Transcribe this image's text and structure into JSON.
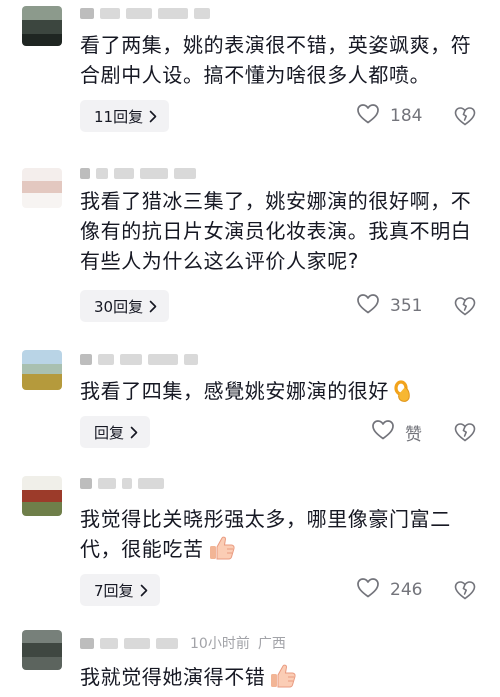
{
  "comments": [
    {
      "text": "看了两集，姚的表演很不错，英姿飒爽，符合剧中人设。搞不懂为啥很多人都喷。",
      "reply_label": "11回复",
      "likes": "184"
    },
    {
      "text": "我看了猎冰三集了，姚安娜演的很好啊，不像有的抗日片女演员化妆表演。我真不明白有些人为什么这么评价人家呢?",
      "reply_label": "30回复",
      "likes": "351"
    },
    {
      "text": "我看了四集，感覺姚安娜演的很好",
      "reply_label": "回复",
      "likes": "赞",
      "emoji": "ok-hand-emoji"
    },
    {
      "text": "我觉得比关晓彤强太多，哪里像豪门富二代，很能吃苦",
      "reply_label": "7回复",
      "likes": "246",
      "emoji": "thumbs-up-emoji"
    },
    {
      "text": "我就觉得她演得不错",
      "meta_time": "10小时前",
      "meta_location": "广西",
      "emoji": "thumbs-up-emoji"
    }
  ],
  "colors": {
    "text": "#161823",
    "meta": "#a2a3a8",
    "pill_bg": "#f2f2f4",
    "icon_gray": "#73747b"
  }
}
